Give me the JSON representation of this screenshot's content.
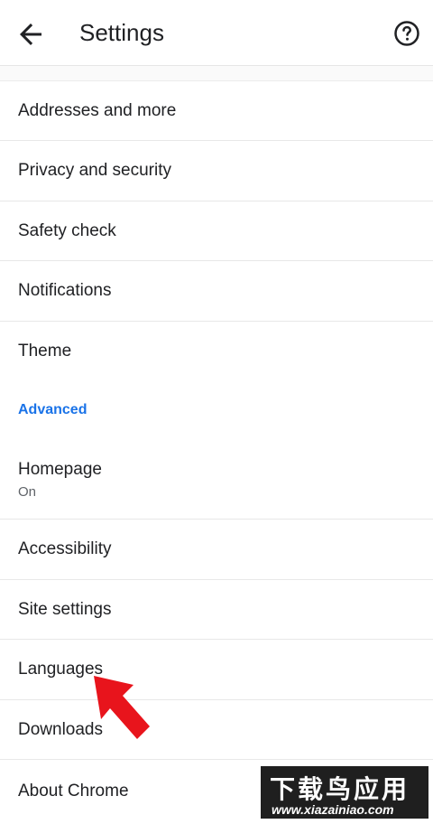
{
  "header": {
    "back_icon": "arrow-left-icon",
    "title": "Settings",
    "help_icon": "help-circle-icon"
  },
  "items": [
    {
      "label": "Addresses and more"
    },
    {
      "label": "Privacy and security"
    },
    {
      "label": "Safety check"
    },
    {
      "label": "Notifications"
    },
    {
      "label": "Theme"
    }
  ],
  "advanced": {
    "section_label": "Advanced",
    "items": [
      {
        "label": "Homepage",
        "sub": "On"
      },
      {
        "label": "Accessibility"
      },
      {
        "label": "Site settings"
      },
      {
        "label": "Languages"
      },
      {
        "label": "Downloads"
      },
      {
        "label": "About Chrome"
      }
    ]
  },
  "overlay": {
    "arrow_icon": "red-pointer-arrow-icon",
    "arrow_color": "#e8141c",
    "watermark_title": "下载鸟应用",
    "watermark_url": "www.xiazainiao.com"
  },
  "colors": {
    "accent": "#1a73e8",
    "text": "#202124",
    "divider": "#e8e8e8"
  }
}
